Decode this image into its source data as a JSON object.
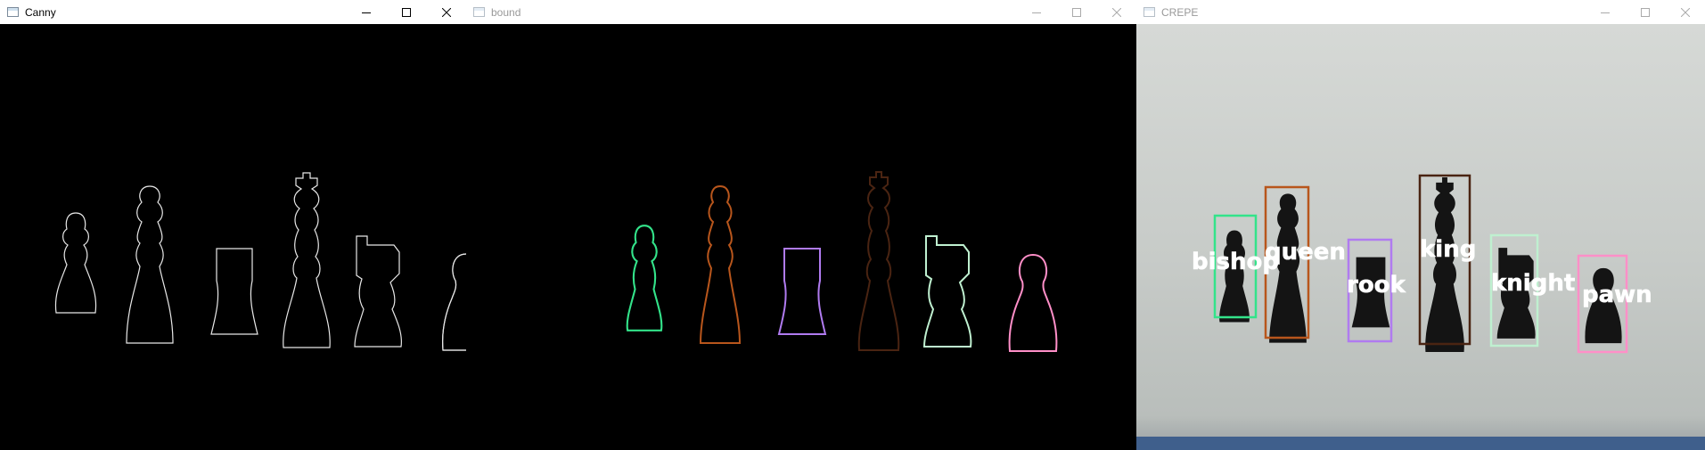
{
  "windows": [
    {
      "title": "Canny",
      "active": true
    },
    {
      "title": "bound",
      "active": false
    },
    {
      "title": "CREPE",
      "active": false
    }
  ],
  "labels": {
    "bishop": "bishop",
    "queen": "queen",
    "rook": "rook",
    "king": "king",
    "knight": "knight",
    "pawn": "pawn"
  },
  "colors": {
    "bishop": "#33e38a",
    "queen": "#b8561c",
    "rook": "#b07bf0",
    "king": "#4a2412",
    "knight": "#bff0d0",
    "pawn": "#ff8fc8",
    "canny_edge": "#e8e8e8"
  },
  "icons": [
    "app-window-icon",
    "minimize-icon",
    "maximize-icon",
    "close-icon"
  ]
}
